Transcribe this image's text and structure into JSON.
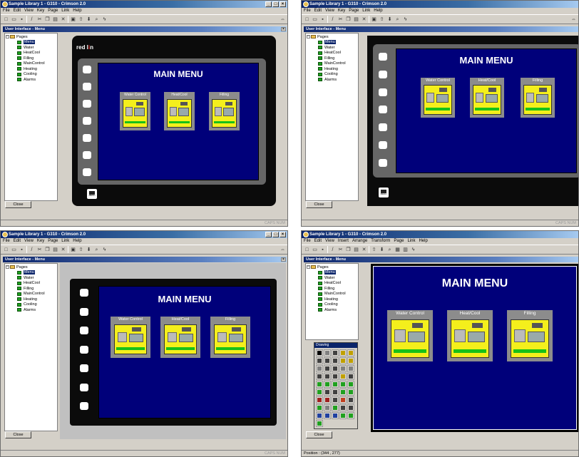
{
  "window": {
    "title": "Sample Library 1 - G310 - Crimson 2.0",
    "minimize_glyph": "_",
    "maximize_glyph": "□",
    "close_glyph": "×"
  },
  "menus": {
    "standard": [
      "File",
      "Edit",
      "View",
      "Key",
      "Page",
      "Link",
      "Help"
    ],
    "drawing": [
      "File",
      "Edit",
      "View",
      "Insert",
      "Arrange",
      "Transform",
      "Page",
      "Link",
      "Help"
    ]
  },
  "toolbar": {
    "icons": [
      "new-icon",
      "open-icon",
      "save-icon",
      "edit-icon",
      "cut-icon",
      "copy-icon",
      "paste-icon",
      "delete-icon",
      "screen-icon",
      "up-icon",
      "down-icon",
      "zoom-icon",
      "lightning-icon"
    ],
    "right_icon": "⇔"
  },
  "pane": {
    "title": "User Interface - Menu",
    "close_glyph": "×"
  },
  "tree": {
    "root": "Pages",
    "expander": "−",
    "items": [
      "Menu",
      "Water",
      "HeatCool",
      "Filling",
      "MainControl",
      "Heating",
      "Cooling",
      "Alarms"
    ],
    "selected": "Menu"
  },
  "hmi": {
    "brand_pre": "red l",
    "brand_o": "i",
    "brand_post": "n",
    "menu_key_label": "MENU",
    "screen": {
      "title": "MAIN MENU",
      "tiles": [
        "Water Control",
        "Heat/Cool",
        "Filling"
      ]
    }
  },
  "drawing_palette": {
    "title": "Drawing",
    "tool_colors": [
      "#000000",
      "#808080",
      "#404040",
      "#c0a000",
      "#c0a000",
      "#404040",
      "#404040",
      "#404040",
      "#c0a000",
      "#c0a000",
      "#808080",
      "#404040",
      "#404040",
      "#808080",
      "#808080",
      "#404040",
      "#404040",
      "#404040",
      "#c0a000",
      "#404040",
      "#20a020",
      "#20a020",
      "#20a020",
      "#20a020",
      "#20a020",
      "#20a020",
      "#404040",
      "#404040",
      "#20a020",
      "#20a020",
      "#a02020",
      "#a02020",
      "#404040",
      "#c04020",
      "#404040",
      "#20a020",
      "#808080",
      "#20a020",
      "#404040",
      "#404040",
      "#2040a0",
      "#2040a0",
      "#2040a0",
      "#20a020",
      "#20a020",
      "#20a020"
    ]
  },
  "buttons": {
    "close": "Close"
  },
  "status": {
    "right": "CAPS  NUM",
    "position": "Position : (344 , 277)"
  },
  "colors": {
    "title_bar": "#0a246a",
    "screen_blue": "#00007a",
    "tile_gray": "#8c8c8c",
    "tile_yellow": "#f4ef1c",
    "bezel_black": "#0b0b0b",
    "bezel_gray": "#666666"
  }
}
